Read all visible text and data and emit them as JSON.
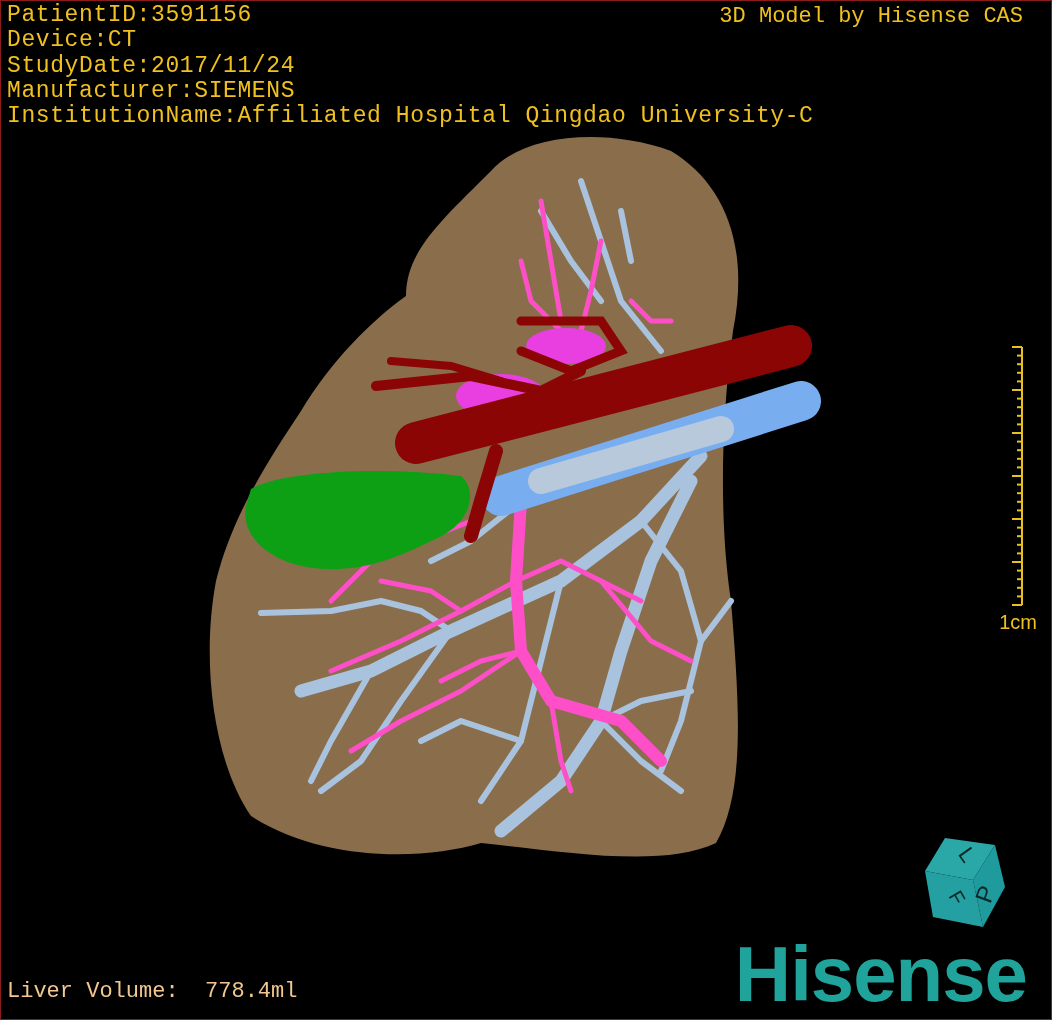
{
  "viewer": {
    "info_lines": [
      "PatientID:3591156",
      "Device:CT",
      "StudyDate:2017/11/24",
      "Manufacturer:SIEMENS",
      "InstitutionName:Affiliated Hospital Qingdao University-C"
    ],
    "title": "3D Model by Hisense CAS",
    "scale_label": "1cm",
    "measurement": "Liver Volume:  778.4ml",
    "orientation_cube": {
      "faces": [
        "L",
        "P",
        "F"
      ]
    },
    "logo": "Hisense"
  }
}
